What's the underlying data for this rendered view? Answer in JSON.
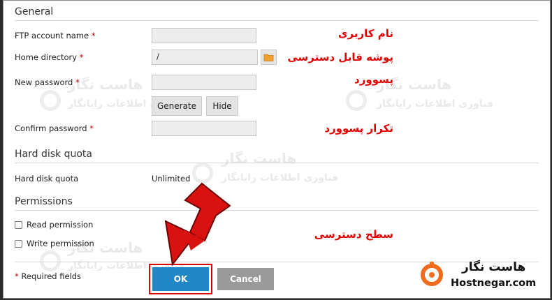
{
  "sections": {
    "general": "General",
    "quota": "Hard disk quota",
    "permissions": "Permissions"
  },
  "fields": {
    "ftp_account": {
      "label": "FTP account name",
      "required_mark": "*",
      "value": ""
    },
    "home_dir": {
      "label": "Home directory",
      "required_mark": "*",
      "value": "/"
    },
    "new_password": {
      "label": "New password",
      "required_mark": "*",
      "value": ""
    },
    "confirm_password": {
      "label": "Confirm password",
      "required_mark": "*",
      "value": ""
    }
  },
  "buttons": {
    "generate": "Generate",
    "hide": "Hide",
    "ok": "OK",
    "cancel": "Cancel"
  },
  "quota": {
    "label": "Hard disk quota",
    "value": "Unlimited"
  },
  "permissions": {
    "read": {
      "label": "Read permission",
      "checked": false
    },
    "write": {
      "label": "Write permission",
      "checked": false
    }
  },
  "footer": {
    "required_mark": "*",
    "required_text": "Required fields"
  },
  "annotations": {
    "username": "نام کاربری",
    "home_folder": "پوشه قابل دسترسی",
    "password": "پسوورد",
    "password_repeat": "تکرار پسوورد",
    "access_level": "سطح دسترسی"
  },
  "brand": {
    "name_fa": "هاست نگار",
    "domain": "Hostnegar.com",
    "watermark_line1": "هاست نگار",
    "watermark_line2": "فناوری اطلاعات رایانگار"
  },
  "colors": {
    "annotation_red": "#e00000",
    "ok_blue": "#1f87c4",
    "cancel_gray": "#9a9a9a",
    "brand_orange": "#f26b1d",
    "required_red": "#c00000"
  },
  "icons": {
    "folder": "folder-icon",
    "arrow": "red-arrow-icon",
    "brand_logo": "hostnegar-logo-icon"
  }
}
